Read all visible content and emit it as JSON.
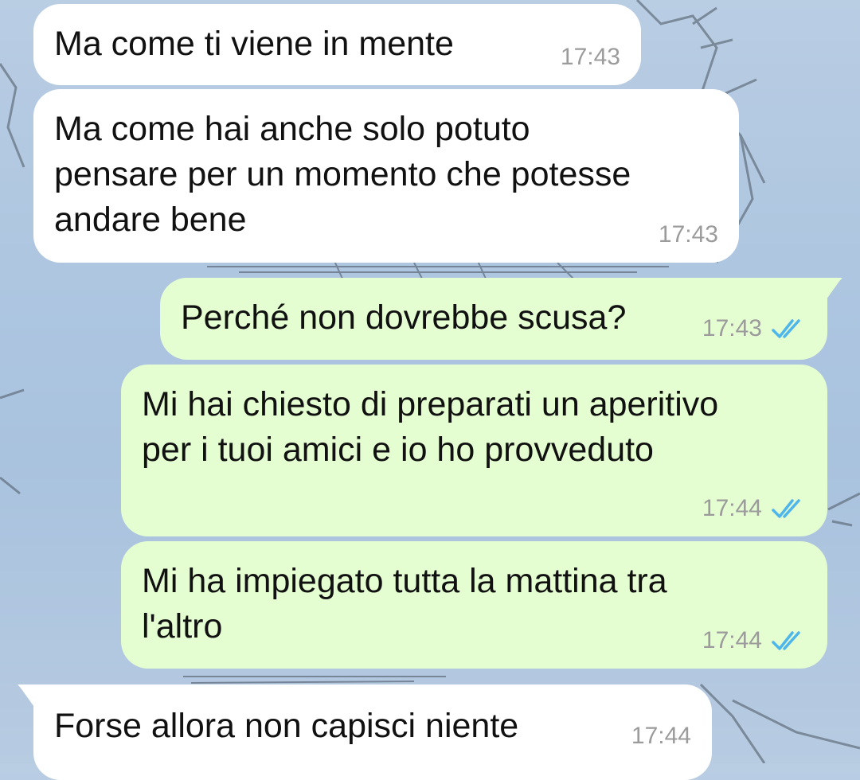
{
  "chat": {
    "messages": [
      {
        "direction": "incoming",
        "text": "Ma come ti viene in mente",
        "time": "17:43"
      },
      {
        "direction": "incoming",
        "text": "Ma come hai anche solo potuto\npensare per un momento che potesse\nandare bene",
        "time": "17:43"
      },
      {
        "direction": "outgoing",
        "text": "Perché non dovrebbe scusa?",
        "time": "17:43",
        "status": "read",
        "status_icon": "double-check-icon"
      },
      {
        "direction": "outgoing",
        "text": "Mi hai chiesto di preparati un aperitivo\nper i tuoi amici e io ho provveduto",
        "time": "17:44",
        "status": "read",
        "status_icon": "double-check-icon"
      },
      {
        "direction": "outgoing",
        "text": "Mi ha impiegato tutta la mattina tra\nl'altro",
        "time": "17:44",
        "status": "read",
        "status_icon": "double-check-icon"
      },
      {
        "direction": "incoming",
        "text": "Forse allora non capisci niente",
        "time": "17:44"
      }
    ]
  },
  "colors": {
    "incoming_bubble": "#ffffff",
    "outgoing_bubble": "#e4fdd1",
    "time_text": "#9b9b9b",
    "read_ticks": "#4fb6ec",
    "wallpaper_sky": "#aec6e0"
  }
}
